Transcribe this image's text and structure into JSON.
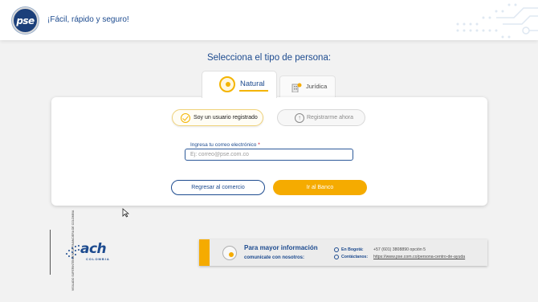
{
  "header": {
    "logo_text": "pse",
    "tagline": "¡Fácil, rápido y seguro!"
  },
  "main": {
    "title": "Selecciona el tipo de persona:",
    "tabs": [
      {
        "label": "Natural",
        "active": true
      },
      {
        "label": "Jurídica",
        "active": false
      }
    ]
  },
  "login": {
    "registered_label": "Soy un usuario registrado",
    "register_label": "Registrarme ahora",
    "email_label": "Ingresa tu correo electrónico",
    "email_required_mark": "*",
    "email_placeholder": "Ej: correo@pse.com.co",
    "email_value": "",
    "back_button": "Regresar al comercio",
    "bank_button": "Ir al Banco"
  },
  "footer": {
    "vigilado_text": "VIGILADO SUPERINTENDENCIA FINANCIERA DE COLOMBIA",
    "ach_logo_text": "ach",
    "ach_sub_text": "COLOMBIA",
    "info_title": "Para mayor información",
    "info_subtitle": "comunícate con nosotros:",
    "bogota_label": "En Bogotá:",
    "bogota_value": "+57 (601) 3808890 opción 5",
    "contact_label": "Contáctanos:",
    "contact_link": "https://www.pse.com.co/persona-centro-de-ayuda"
  },
  "colors": {
    "brand_blue": "#1d4b8f",
    "accent_yellow": "#f5ab00"
  }
}
